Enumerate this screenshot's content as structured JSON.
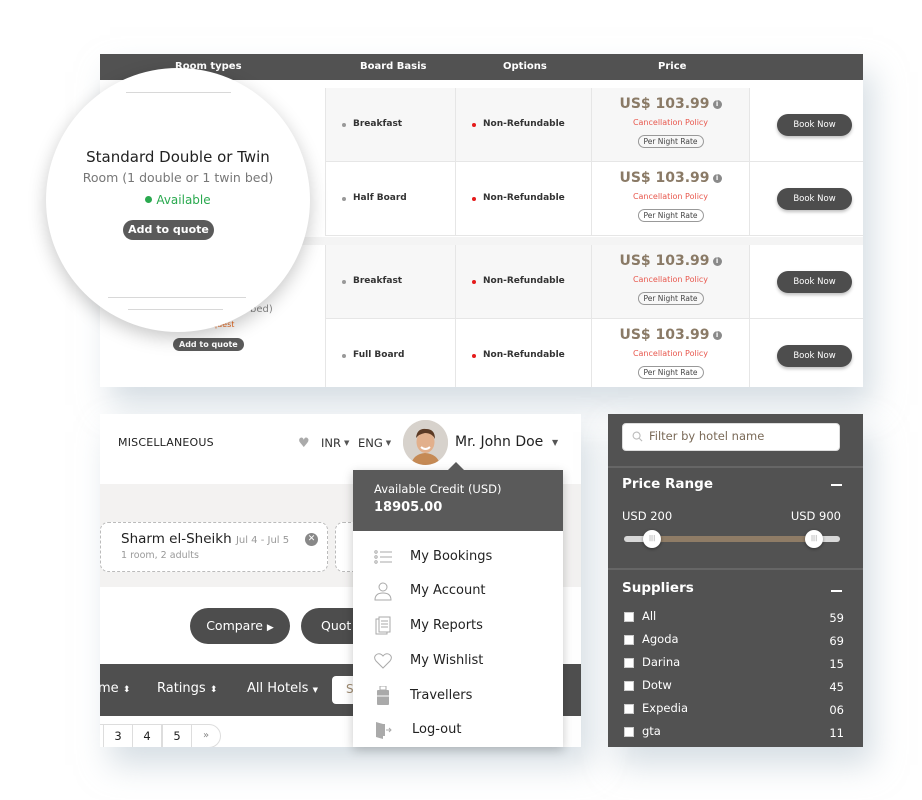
{
  "room_table": {
    "headers": [
      "Room types",
      "Board Basis",
      "Options",
      "Price"
    ],
    "magnified_room": {
      "title": "Standard Double or Twin",
      "subtitle": "Room (1 double or 1 twin bed)",
      "status": "Available",
      "add_label": "Add to quote"
    },
    "second_room": {
      "subtitle_fragment": "bed)",
      "status_fragment": "quest",
      "add_label": "Add to quote"
    },
    "rows": [
      {
        "board": "Breakfast",
        "option": "Non-Refundable",
        "price": "US$ 103.99",
        "cancel": "Cancellation Policy",
        "rate": "Per Night Rate",
        "book": "Book Now"
      },
      {
        "board": "Half Board",
        "option": "Non-Refundable",
        "price": "US$ 103.99",
        "cancel": "Cancellation Policy",
        "rate": "Per Night Rate",
        "book": "Book Now"
      },
      {
        "board": "Breakfast",
        "option": "Non-Refundable",
        "price": "US$ 103.99",
        "cancel": "Cancellation Policy",
        "rate": "Per Night Rate",
        "book": "Book Now"
      },
      {
        "board": "Full Board",
        "option": "Non-Refundable",
        "price": "US$ 103.99",
        "cancel": "Cancellation Policy",
        "rate": "Per Night Rate",
        "book": "Book Now"
      }
    ]
  },
  "header": {
    "nav_item": "MISCELLANEOUS",
    "currency": "INR",
    "language": "ENG",
    "user_name": "Mr. John Doe"
  },
  "search": {
    "destination": "Sharm el-Sheikh",
    "dates": "Jul 4 - Jul 5",
    "occupancy": "1 room, 2 adults"
  },
  "actions": {
    "compare_label": "Compare",
    "quote_label": "Quot"
  },
  "sortbar": {
    "items": [
      "me",
      "Ratings",
      "All Hotels"
    ],
    "search_fragment": "S"
  },
  "pagination": {
    "pages": [
      "3",
      "4",
      "5"
    ],
    "next": "»"
  },
  "user_menu": {
    "credit_label": "Available Credit (USD)",
    "credit_value": "18905.00",
    "items": [
      {
        "label": "My Bookings",
        "icon": "list-icon"
      },
      {
        "label": "My Account",
        "icon": "user-icon"
      },
      {
        "label": "My Reports",
        "icon": "report-icon"
      },
      {
        "label": "My Wishlist",
        "icon": "heart-icon"
      },
      {
        "label": "Travellers",
        "icon": "luggage-icon"
      },
      {
        "label": "Log-out",
        "icon": "logout-icon"
      }
    ]
  },
  "filters": {
    "hotel_filter_placeholder": "Filter by hotel name",
    "price_range": {
      "title": "Price Range",
      "min_label": "USD 200",
      "max_label": "USD 900",
      "min_fraction": 0.13,
      "max_fraction": 0.88
    },
    "suppliers": {
      "title": "Suppliers",
      "items": [
        {
          "name": "All",
          "count": "59"
        },
        {
          "name": "Agoda",
          "count": "69"
        },
        {
          "name": "Darina",
          "count": "15"
        },
        {
          "name": "Dotw",
          "count": "45"
        },
        {
          "name": "Expedia",
          "count": "06"
        },
        {
          "name": "gta",
          "count": "11"
        }
      ]
    }
  }
}
